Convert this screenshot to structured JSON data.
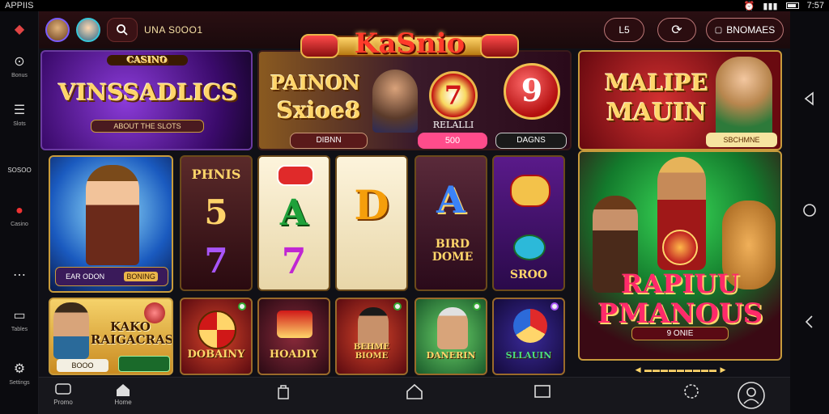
{
  "status": {
    "left": "APPIIS",
    "time": "7:57"
  },
  "sidebar": [
    {
      "label": "",
      "icon": "cube-icon"
    },
    {
      "label": "Bonus",
      "icon": "target-icon"
    },
    {
      "label": "Slots",
      "icon": "list-icon"
    },
    {
      "label": "SOSOO",
      "icon": "text-icon"
    },
    {
      "label": "Casino",
      "icon": "record-icon"
    },
    {
      "label": "",
      "icon": "more-icon"
    },
    {
      "label": "Tables",
      "icon": "window-icon"
    },
    {
      "label": "Settings",
      "icon": "gear-icon"
    }
  ],
  "topbar": {
    "name": "UNA S0OO1",
    "logo": "KaSnio",
    "btn_level": "L5",
    "btn_refresh_icon": "refresh-icon",
    "btn_bonus": "BNOMAES"
  },
  "banners": {
    "left": {
      "title": "VINSSADLICS",
      "top": "CASINO",
      "sub": "ABOUT THE SLOTS"
    },
    "center": {
      "title1": "PAINON",
      "title2": "Sxioe8",
      "chip1": "DIBNN",
      "game_label": "RELALLI",
      "chip2": "500",
      "chip3": "DAGNS",
      "number": "9"
    },
    "right": {
      "title1": "MALIPE",
      "title2": "MAUIN",
      "chip": "SBCHMNE"
    }
  },
  "cowgirl": {
    "label1": "EAR ODON",
    "label2": "BONING"
  },
  "reels": [
    {
      "top": "PHNIS",
      "mid": "5",
      "bot": "7"
    },
    {
      "top": "",
      "mid": "A",
      "bot": "7"
    },
    {
      "top": "",
      "mid": "D",
      "bot": ""
    },
    {
      "top": "",
      "mid": "A",
      "bot": "BIRD DOME"
    },
    {
      "top": "",
      "mid": "",
      "bot": "SROO"
    }
  ],
  "hero": {
    "title1": "RAPIUU",
    "title2": "PMANOUS",
    "sub": "9 ONIE"
  },
  "promo": {
    "title": "KAKO RAIGACRAS",
    "btn1": "BOOO",
    "btn2": ""
  },
  "games": [
    {
      "label": "DOBAINY"
    },
    {
      "label": "HOADIY"
    },
    {
      "label": "BEHME BIOME"
    },
    {
      "label": "DANERIN"
    },
    {
      "label": "SLLAUIN"
    }
  ],
  "bottomnav": [
    {
      "label": "Promo",
      "icon": "chat-icon"
    },
    {
      "label": "Home",
      "icon": "home-icon"
    },
    {
      "label": "",
      "icon": "bag-icon"
    },
    {
      "label": "",
      "icon": "android-home-icon"
    },
    {
      "label": "",
      "icon": "recents-icon"
    },
    {
      "label": "",
      "icon": "people-icon"
    },
    {
      "label": "",
      "icon": "profile-icon"
    }
  ]
}
